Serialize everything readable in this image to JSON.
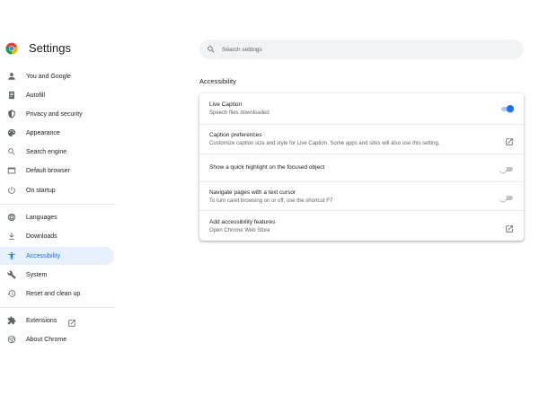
{
  "app": {
    "title": "Settings"
  },
  "search": {
    "placeholder": "Search settings",
    "value": ""
  },
  "sidebar": {
    "items": [
      {
        "label": "You and Google",
        "icon": "person-icon",
        "active": false
      },
      {
        "label": "Autofill",
        "icon": "clipboard-icon",
        "active": false
      },
      {
        "label": "Privacy and security",
        "icon": "shield-icon",
        "active": false
      },
      {
        "label": "Appearance",
        "icon": "palette-icon",
        "active": false
      },
      {
        "label": "Search engine",
        "icon": "search-icon",
        "active": false
      },
      {
        "label": "Default browser",
        "icon": "browser-icon",
        "active": false
      },
      {
        "label": "On startup",
        "icon": "power-icon",
        "active": false
      },
      {
        "label": "Languages",
        "icon": "globe-icon",
        "active": false
      },
      {
        "label": "Downloads",
        "icon": "download-icon",
        "active": false
      },
      {
        "label": "Accessibility",
        "icon": "accessibility-icon",
        "active": true
      },
      {
        "label": "System",
        "icon": "wrench-icon",
        "active": false
      },
      {
        "label": "Reset and clean up",
        "icon": "restore-icon",
        "active": false
      },
      {
        "label": "Extensions",
        "icon": "puzzle-icon",
        "active": false
      },
      {
        "label": "About Chrome",
        "icon": "chrome-icon",
        "active": false
      }
    ]
  },
  "main": {
    "section_title": "Accessibility",
    "rows": [
      {
        "title": "Live Caption",
        "subtitle": "Speech files downloaded",
        "control": "toggle",
        "on": true
      },
      {
        "title": "Caption preferences",
        "subtitle": "Customize caption size and style for Live Caption. Some apps and sites will also use this setting.",
        "control": "launch-icon"
      },
      {
        "title": "Show a quick highlight on the focused object",
        "subtitle": "",
        "control": "toggle",
        "on": false
      },
      {
        "title": "Navigate pages with a text cursor",
        "subtitle": "To turn caret browsing on or off, use the shortcut F7",
        "control": "toggle",
        "on": false
      },
      {
        "title": "Add accessibility features",
        "subtitle": "Open Chrome Web Store",
        "control": "launch-icon"
      }
    ]
  },
  "colors": {
    "accent": "#1a73e8",
    "active_bg": "#e8f0fe",
    "text_primary": "#202124",
    "text_secondary": "#5f6368"
  }
}
